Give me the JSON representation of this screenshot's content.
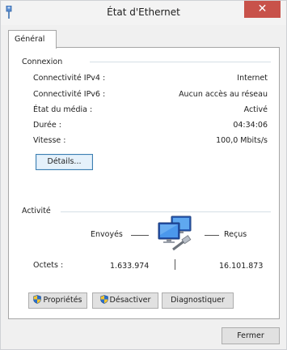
{
  "window": {
    "title": "État d'Ethernet",
    "close_glyph": "✕"
  },
  "tabs": [
    {
      "label": "Général"
    }
  ],
  "connexion": {
    "group_label": "Connexion",
    "rows": [
      {
        "label": "Connectivité IPv4 :",
        "value": "Internet"
      },
      {
        "label": "Connectivité IPv6 :",
        "value": "Aucun accès au réseau"
      },
      {
        "label": "État du média :",
        "value": "Activé"
      },
      {
        "label": "Durée :",
        "value": "04:34:06"
      },
      {
        "label": "Vitesse :",
        "value": "100,0 Mbits/s"
      }
    ],
    "details_button": "Détails..."
  },
  "activite": {
    "group_label": "Activité",
    "sent_label": "Envoyés",
    "received_label": "Reçus",
    "bytes_label": "Octets :",
    "bytes_sent": "1.633.974",
    "bytes_received": "16.101.873"
  },
  "actions": {
    "properties": "Propriétés",
    "disable": "Désactiver",
    "diagnose": "Diagnostiquer"
  },
  "footer": {
    "close_button": "Fermer"
  },
  "colors": {
    "close_red": "#c8524a",
    "shield_blue": "#2a6fc9",
    "shield_yellow": "#f4c430"
  }
}
